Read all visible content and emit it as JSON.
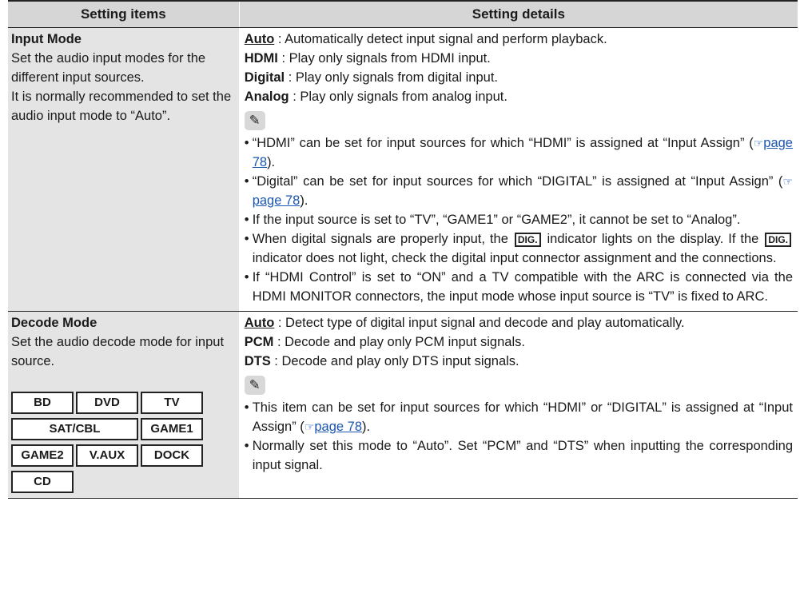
{
  "header": {
    "col1": "Setting items",
    "col2": "Setting details"
  },
  "input_mode": {
    "title": "Input Mode",
    "desc": "Set the audio input modes for the different input sources.",
    "desc2": "It is normally recommended to set the audio input mode to “Auto”.",
    "options": [
      {
        "name": "Auto",
        "text": " : Automatically detect input signal and perform playback."
      },
      {
        "name": "HDMI",
        "text": " : Play only signals from HDMI input."
      },
      {
        "name": "Digital",
        "text": " : Play only signals from digital input."
      },
      {
        "name": "Analog",
        "text": " : Play only signals from analog input."
      }
    ],
    "note1_a": "“HDMI” can be set for input sources for which “HDMI” is assigned at “Input Assign” (",
    "note1_link": "page 78",
    "note1_b": ").",
    "note2_a": "“Digital” can be set for input sources for which “DIGITAL” is assigned at “Input Assign” (",
    "note2_link": "page 78",
    "note2_b": ").",
    "note3": "If the input source is set to “TV”, “GAME1” or “GAME2”, it cannot be set to “Analog”.",
    "note4_a": "When digital signals are properly input, the ",
    "note4_b": " indicator lights on the display. If the ",
    "note4_c": " indicator does not light, check the digital input connector assignment and the connections.",
    "dig_label": "DIG.",
    "note5": "If “HDMI Control” is set to “ON” and a TV compatible with the ARC is connected via the HDMI MONITOR connectors, the input mode whose input source is “TV” is fixed to ARC."
  },
  "decode_mode": {
    "title": "Decode Mode",
    "desc": "Set the audio decode mode for input source.",
    "options": [
      {
        "name": "Auto",
        "text": " : Detect type of digital input signal and decode and play automatically."
      },
      {
        "name": "PCM",
        "text": " : Decode and play only PCM input signals."
      },
      {
        "name": "DTS",
        "text": " : Decode and play only DTS input signals."
      }
    ],
    "note1_a": "This item can be set for input sources for which “HDMI” or “DIGITAL” is assigned at “Input Assign” (",
    "note1_link": "page 78",
    "note1_b": ").",
    "note2": "Normally set this mode to “Auto”. Set “PCM” and “DTS” when inputting the corresponding input signal.",
    "sources": [
      "BD",
      "DVD",
      "TV",
      "SAT/CBL",
      "GAME1",
      "GAME2",
      "V.AUX",
      "DOCK",
      "CD"
    ]
  },
  "glyphs": {
    "bullet": "•",
    "pencil": "✎",
    "ref": "☞"
  }
}
